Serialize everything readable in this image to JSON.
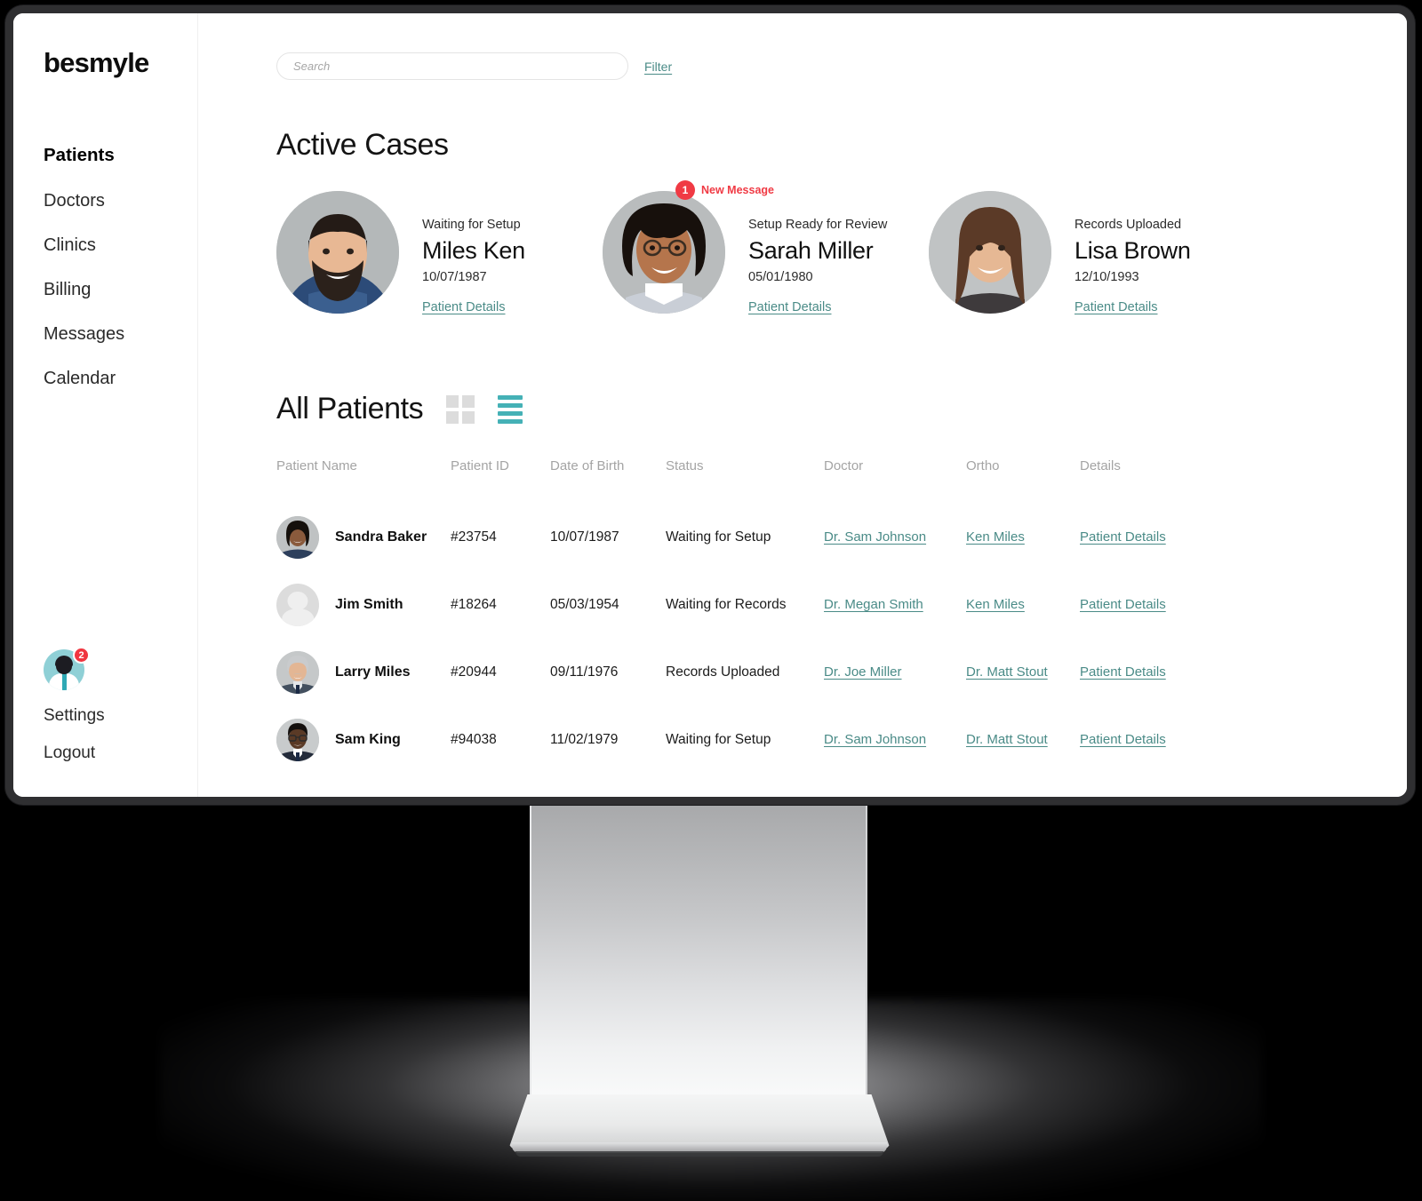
{
  "brand": "besmyle",
  "sidebar": {
    "nav": [
      {
        "label": "Patients",
        "active": true
      },
      {
        "label": "Doctors",
        "active": false
      },
      {
        "label": "Clinics",
        "active": false
      },
      {
        "label": "Billing",
        "active": false
      },
      {
        "label": "Messages",
        "active": false
      },
      {
        "label": "Calendar",
        "active": false
      }
    ],
    "avatar_badge": "2",
    "settings_label": "Settings",
    "logout_label": "Logout"
  },
  "topbar": {
    "search_placeholder": "Search",
    "search_value": "",
    "filter_label": "Filter"
  },
  "active_cases": {
    "title": "Active Cases",
    "details_label": "Patient Details",
    "cards": [
      {
        "status": "Waiting for Setup",
        "name": "Miles Ken",
        "dob": "10/07/1987",
        "link": "Patient Details",
        "badge": null,
        "badge_text": null
      },
      {
        "status": "Setup Ready for Review",
        "name": "Sarah Miller",
        "dob": "05/01/1980",
        "link": "Patient Details",
        "badge": "1",
        "badge_text": "New Message"
      },
      {
        "status": "Records Uploaded",
        "name": "Lisa Brown",
        "dob": "12/10/1993",
        "link": "Patient Details",
        "badge": null,
        "badge_text": null
      }
    ]
  },
  "all_patients": {
    "title": "All Patients",
    "view_grid_icon": "grid-view-icon",
    "view_list_icon": "list-view-icon",
    "active_view": "list",
    "columns": [
      "Patient Name",
      "Patient ID",
      "Date of Birth",
      "Status",
      "Doctor",
      "Ortho",
      "Details"
    ],
    "rows": [
      {
        "name": "Sandra Baker",
        "id": "#23754",
        "dob": "10/07/1987",
        "status": "Waiting for Setup",
        "doctor": "Dr. Sam Johnson",
        "ortho": "Ken Miles",
        "details": "Patient Details"
      },
      {
        "name": "Jim Smith",
        "id": "#18264",
        "dob": "05/03/1954",
        "status": "Waiting for Records",
        "doctor": "Dr. Megan Smith",
        "ortho": "Ken Miles",
        "details": "Patient Details"
      },
      {
        "name": "Larry Miles",
        "id": "#20944",
        "dob": "09/11/1976",
        "status": "Records Uploaded",
        "doctor": "Dr. Joe Miller",
        "ortho": "Dr. Matt Stout",
        "details": "Patient Details"
      },
      {
        "name": "Sam King",
        "id": "#94038",
        "dob": "11/02/1979",
        "status": "Waiting for Setup",
        "doctor": "Dr. Sam Johnson",
        "ortho": "Dr. Matt Stout",
        "details": "Patient Details"
      }
    ]
  },
  "colors": {
    "accent_teal": "#4a8b87",
    "list_icon_teal": "#45b1b6",
    "alert_red": "#f03a44",
    "avatar_bg": "#8fd0d6",
    "muted_gray": "#a4a4a4",
    "bezel": "#2f2f31"
  }
}
